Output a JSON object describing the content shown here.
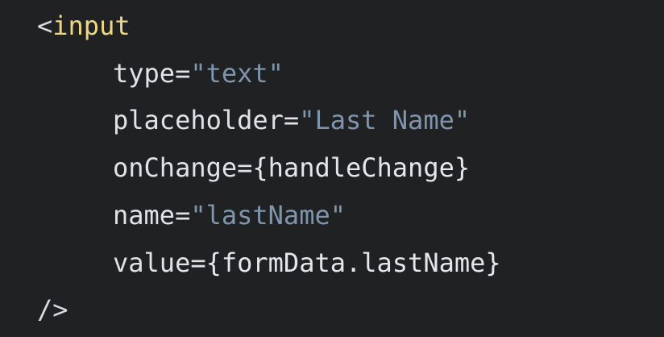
{
  "code": {
    "open_bracket": "<",
    "tag_name": "input",
    "lines": [
      {
        "attr": "type",
        "eq": "=",
        "value": "\"text\""
      },
      {
        "attr": "placeholder",
        "eq": "=",
        "value": "\"Last Name\""
      },
      {
        "attr": "onChange",
        "eq": "=",
        "value": "{handleChange}"
      },
      {
        "attr": "name",
        "eq": "=",
        "value": "\"lastName\""
      },
      {
        "attr": "value",
        "eq": "=",
        "value": "{formData.lastName}"
      }
    ],
    "self_close": "/>"
  },
  "colors": {
    "background": "#202123",
    "tag": "#efd785",
    "attribute": "#dfe3e8",
    "string": "#7f95ad"
  }
}
